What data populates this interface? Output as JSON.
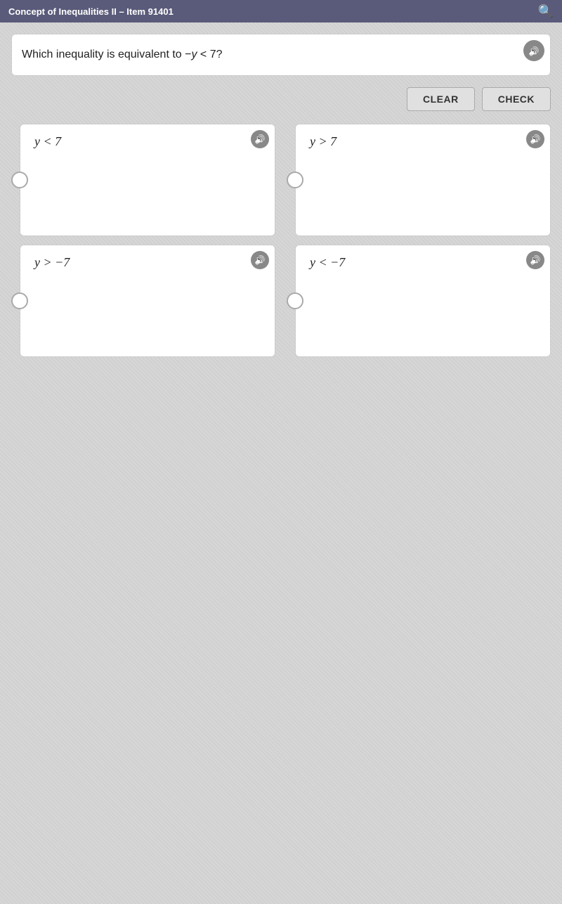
{
  "header": {
    "title": "Concept of Inequalities II – Item 91401",
    "search_icon": "search-icon"
  },
  "question": {
    "text": "Which inequality is equivalent to −y < 7?",
    "text_html": "Which inequality is equivalent to &minus;y &lt; 7?",
    "audio_label": "Play audio"
  },
  "controls": {
    "clear_label": "CLEAR",
    "check_label": "CHECK"
  },
  "options": [
    {
      "id": "A",
      "text": "y < 7",
      "text_html": "y &lt; 7",
      "audio_label": "Play audio for option A"
    },
    {
      "id": "B",
      "text": "y > 7",
      "text_html": "y &gt; 7",
      "audio_label": "Play audio for option B"
    },
    {
      "id": "C",
      "text": "y > −7",
      "text_html": "y &gt; &minus;7",
      "audio_label": "Play audio for option C"
    },
    {
      "id": "D",
      "text": "y < −7",
      "text_html": "y &lt; &minus;7",
      "audio_label": "Play audio for option D"
    }
  ]
}
